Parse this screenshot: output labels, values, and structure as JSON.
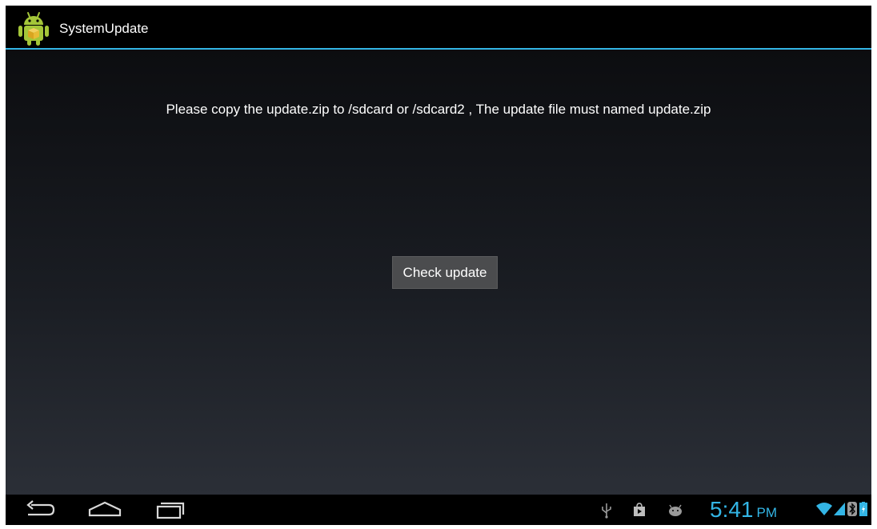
{
  "app": {
    "title": "SystemUpdate",
    "icon": "android-package-icon"
  },
  "main": {
    "message": "Please copy the update.zip to /sdcard or /sdcard2 , The update file must named update.zip",
    "check_button_label": "Check update"
  },
  "navbar": {
    "buttons": [
      "back-icon",
      "home-icon",
      "recent-apps-icon"
    ]
  },
  "statusbar": {
    "notification_icons": [
      "usb-icon",
      "shopping-bag-icon",
      "android-debug-icon"
    ],
    "time": "5:41",
    "ampm": "PM",
    "system_icons": [
      "wifi-icon",
      "signal-icon",
      "bluetooth-icon",
      "battery-icon"
    ]
  },
  "colors": {
    "accent": "#33b5e5",
    "button_bg": "#4b4c4e",
    "android_green": "#a4c639"
  }
}
